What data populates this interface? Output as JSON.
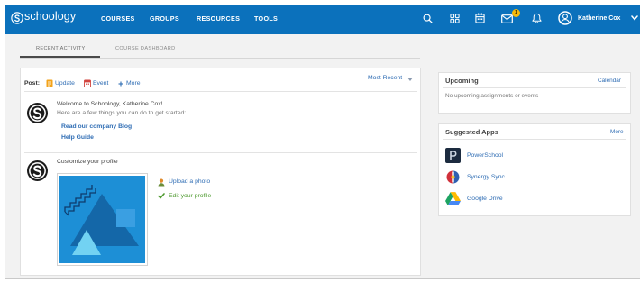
{
  "theme": {
    "header_bg": "#0b71bc",
    "link": "#2f6db4",
    "success": "#4e9a2f",
    "page_bg": "#f2f2f2",
    "badge": "#f6b90a"
  },
  "header": {
    "logo_icon": "schoology-logo-icon",
    "logo_text": "schoology",
    "nav": [
      {
        "label": "COURSES"
      },
      {
        "label": "GROUPS"
      },
      {
        "label": "RESOURCES"
      },
      {
        "label": "TOOLS"
      }
    ],
    "utility_icons": [
      "search-icon",
      "apps-grid-icon",
      "calendar-icon",
      "messages-icon",
      "notifications-bell-icon"
    ],
    "messages_badge": "1",
    "user": {
      "name": "Katherine Cox",
      "avatar_icon": "user-avatar-icon",
      "menu_icon": "chevron-down-icon"
    }
  },
  "tabs": [
    {
      "label": "RECENT ACTIVITY",
      "active": true
    },
    {
      "label": "COURSE DASHBOARD",
      "active": false
    }
  ],
  "feed": {
    "post_label": "Post:",
    "post_actions": [
      {
        "label": "Update",
        "icon": "update-icon"
      },
      {
        "label": "Event",
        "icon": "event-calendar-icon"
      },
      {
        "label": "More",
        "icon": "plus-icon"
      }
    ],
    "sort": {
      "label": "Most Recent",
      "icon": "caret-down-icon"
    },
    "items": [
      {
        "avatar_icon": "schoology-logo-icon",
        "title": "Welcome to Schoology, Katherine Cox!",
        "subtitle": "Here are a few things you can do to get started:",
        "links": [
          "Read our company Blog",
          "Help Guide"
        ]
      },
      {
        "avatar_icon": "schoology-logo-icon",
        "title": "Customize your profile",
        "image": "profile-illustration",
        "actions": [
          {
            "label": "Upload a photo",
            "icon": "person-icon",
            "done": false
          },
          {
            "label": "Edit your profile",
            "icon": "check-icon",
            "done": true
          }
        ]
      }
    ]
  },
  "sidebar": {
    "upcoming": {
      "title": "Upcoming",
      "link": "Calendar",
      "empty_text": "No upcoming assignments or events"
    },
    "suggested_apps": {
      "title": "Suggested Apps",
      "link": "More",
      "apps": [
        {
          "name": "PowerSchool",
          "icon": "powerschool-icon"
        },
        {
          "name": "Synergy Sync",
          "icon": "synergy-sync-icon"
        },
        {
          "name": "Google Drive",
          "icon": "google-drive-icon"
        }
      ]
    }
  }
}
